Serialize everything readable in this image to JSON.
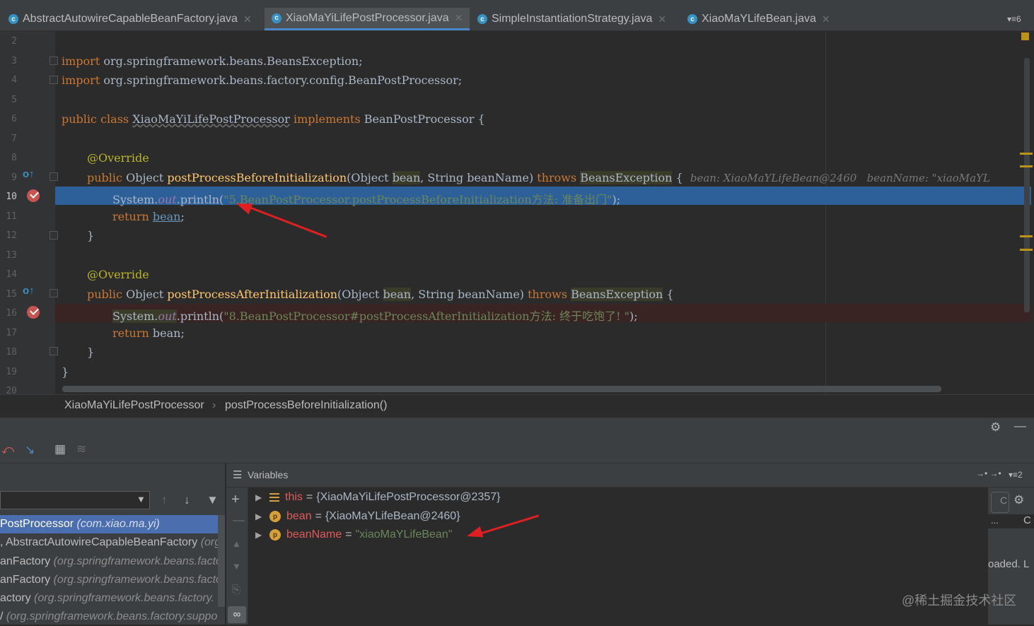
{
  "tabs": [
    {
      "label": "AbstractAutowireCapableBeanFactory.java",
      "icon": "class-icon",
      "active": false
    },
    {
      "label": "XiaoMaYiLifePostProcessor.java",
      "icon": "class-icon",
      "active": true
    },
    {
      "label": "SimpleInstantiationStrategy.java",
      "icon": "class-icon",
      "active": false
    },
    {
      "label": "XiaoMaYLifeBean.java",
      "icon": "class-icon",
      "active": false
    }
  ],
  "tab_overflow": "≡6",
  "editor": {
    "line_numbers": [
      "2",
      "3",
      "4",
      "5",
      "6",
      "7",
      "8",
      "9",
      "10",
      "11",
      "12",
      "13",
      "14",
      "15",
      "16",
      "17",
      "18",
      "19",
      "20"
    ],
    "lines": {
      "l3_kw": "import",
      "l3_rest": " org.springframework.beans.BeansException;",
      "l4_kw": "import",
      "l4_rest": " org.springframework.beans.factory.config.BeanPostProcessor;",
      "l6_kw1": "public class ",
      "l6_name": "XiaoMaYiLifePostProcessor",
      "l6_kw2": " implements ",
      "l6_rest": "BeanPostProcessor {",
      "l8_ann": "@Override",
      "l9_kw": "public ",
      "l9_type": "Object ",
      "l9_fn": "postProcessBeforeInitialization",
      "l9_p1": "(Object ",
      "l9_bean": "bean",
      "l9_p2": ", String beanName) ",
      "l9_throws": "throws",
      "l9_exc": "BeansException",
      "l9_end": " {",
      "l9_hint": "bean: XiaoMaYLifeBean@2460   beanName: \"xiaoMaYL",
      "l10_sys": "System.",
      "l10_out": "out",
      "l10_mid": ".println(",
      "l10_str": "\"5.BeanPostProcessor.postProcessBeforeInitialization方法: 准备出门\"",
      "l10_end": ");",
      "l11_kw": "return ",
      "l11_bean": "bean",
      "l11_end": ";",
      "l12": "}",
      "l14_ann": "@Override",
      "l15_kw": "public ",
      "l15_type": "Object ",
      "l15_fn": "postProcessAfterInitialization",
      "l15_p1": "(Object ",
      "l15_bean": "bean",
      "l15_p2": ", String beanName) ",
      "l15_throws": "throws",
      "l15_exc": "BeansException",
      "l15_end": " {",
      "l16_sys": "System.",
      "l16_out": "out",
      "l16_mid": ".println(",
      "l16_str": "\"8.BeanPostProcessor#postProcessAfterInitialization方法: 终于吃饱了! \"",
      "l16_end": ");",
      "l17_kw": "return ",
      "l17_rest": "bean;",
      "l18": "}",
      "l19": "}"
    }
  },
  "breadcrumb": [
    "XiaoMaYiLifePostProcessor",
    "postProcessBeforeInitialization()"
  ],
  "breadcrumb_sep": "›",
  "debug": {
    "variables_title": "Variables",
    "frames": [
      {
        "method": "PostProcessor ",
        "pkg": "(com.xiao.ma.yi)",
        "selected": true
      },
      {
        "method": ", AbstractAutowireCapableBeanFactory ",
        "pkg": "(org",
        "selected": false
      },
      {
        "method": "anFactory ",
        "pkg": "(org.springframework.beans.facto",
        "selected": false
      },
      {
        "method": "anFactory ",
        "pkg": "(org.springframework.beans.facto",
        "selected": false
      },
      {
        "method": "actory ",
        "pkg": "(org.springframework.beans.factory.",
        "selected": false
      },
      {
        "method": "/ ",
        "pkg": "(org.springframework.beans.factory.suppo",
        "selected": false
      }
    ],
    "variables": [
      {
        "name": "this",
        "eq": "=",
        "value": "{XiaoMaYiLifePostProcessor@2357}",
        "kind": "list"
      },
      {
        "name": "bean",
        "eq": "=",
        "value": "{XiaoMaYLifeBean@2460}",
        "kind": "p"
      },
      {
        "name": "beanName",
        "eq": "=",
        "value": "\"xiaoMaYLifeBean\"",
        "kind": "p"
      }
    ],
    "vars_overflow": "≡2",
    "right_fragments": {
      "c": "C",
      "dots": "...",
      "loaded": "oaded. L"
    }
  },
  "watermark": "@稀土掘金技术社区",
  "colors": {
    "selection": "#2d6099",
    "breakpoint": "#c75450",
    "keyword": "#cc7832",
    "string": "#6a8759",
    "annotation_arrow": "#e02020"
  }
}
